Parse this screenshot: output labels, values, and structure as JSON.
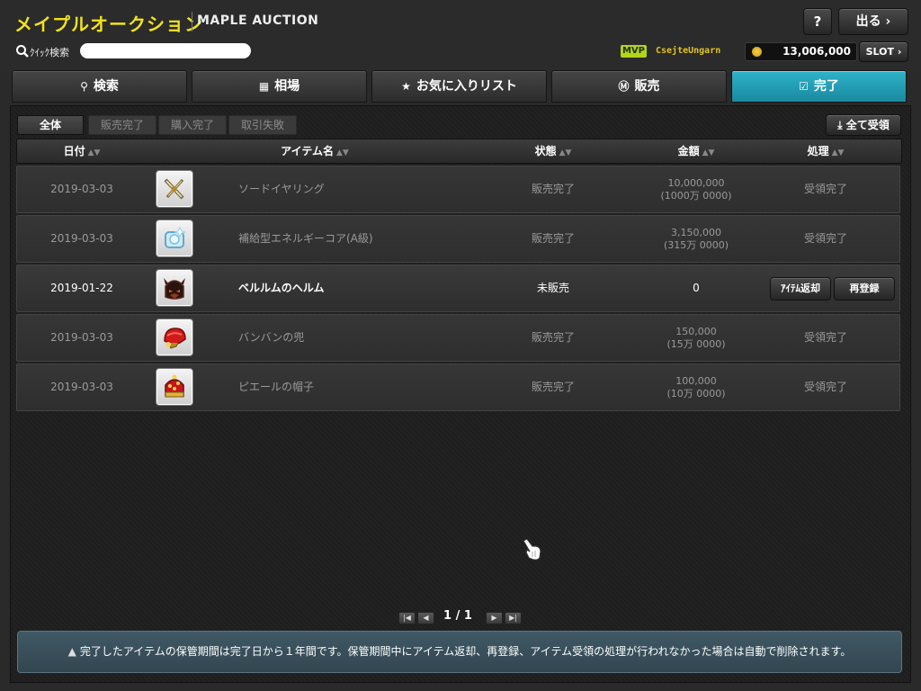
{
  "header": {
    "title_jp": "メイプルオークション",
    "title_en": "MAPLE AUCTION",
    "help_label": "?",
    "exit_label": "出る",
    "search_label": "ｸｲｯｸ検索",
    "search_value": "",
    "mvp_badge": "MVP",
    "username": "CsejteUngarn",
    "meso": "13,006,000",
    "slot_label": "SLOT"
  },
  "tabs": [
    {
      "label": "検索",
      "icon": "search-icon"
    },
    {
      "label": "相場",
      "icon": "bar-chart-icon"
    },
    {
      "label": "お気に入りリスト",
      "icon": "star-icon"
    },
    {
      "label": "販売",
      "icon": "sale-coin-icon"
    },
    {
      "label": "完了",
      "icon": "checkbox-icon",
      "active": true
    }
  ],
  "filters": [
    "全体",
    "販売完了",
    "購入完了",
    "取引失敗"
  ],
  "receive_all_label": "全て受領",
  "columns": [
    "日付",
    "アイテム名",
    "状態",
    "金額",
    "処理"
  ],
  "rows": [
    {
      "date": "2019-03-03",
      "name": "ソードイヤリング",
      "state": "販売完了",
      "price": "10,000,000",
      "price_sub": "(1000万 0000)",
      "process": "受領完了",
      "icon": "sword-earring-icon"
    },
    {
      "date": "2019-03-03",
      "name": "補給型エネルギーコア(A級)",
      "state": "販売完了",
      "price": "3,150,000",
      "price_sub": "(315万 0000)",
      "process": "受領完了",
      "icon": "energy-core-icon"
    },
    {
      "date": "2019-01-22",
      "name": "ベルルムのヘルム",
      "state": "未販売",
      "price": "0",
      "price_sub": "",
      "process": "",
      "return_label": "ｱｲﾃﾑ返却",
      "relist_label": "再登録",
      "icon": "vellum-helm-icon"
    },
    {
      "date": "2019-03-03",
      "name": "バンバンの兜",
      "state": "販売完了",
      "price": "150,000",
      "price_sub": "(15万 0000)",
      "process": "受領完了",
      "icon": "red-helmet-icon"
    },
    {
      "date": "2019-03-03",
      "name": "ピエールの帽子",
      "state": "販売完了",
      "price": "100,000",
      "price_sub": "(10万 0000)",
      "process": "受領完了",
      "icon": "pierre-hat-icon"
    }
  ],
  "pager": {
    "text": "1 / 1"
  },
  "notice": "完了したアイテムの保管期間は完了日から１年間です。保管期間中にアイテム返却、再登録、アイテム受領の処理が行われなかった場合は自動で削除されます。"
}
